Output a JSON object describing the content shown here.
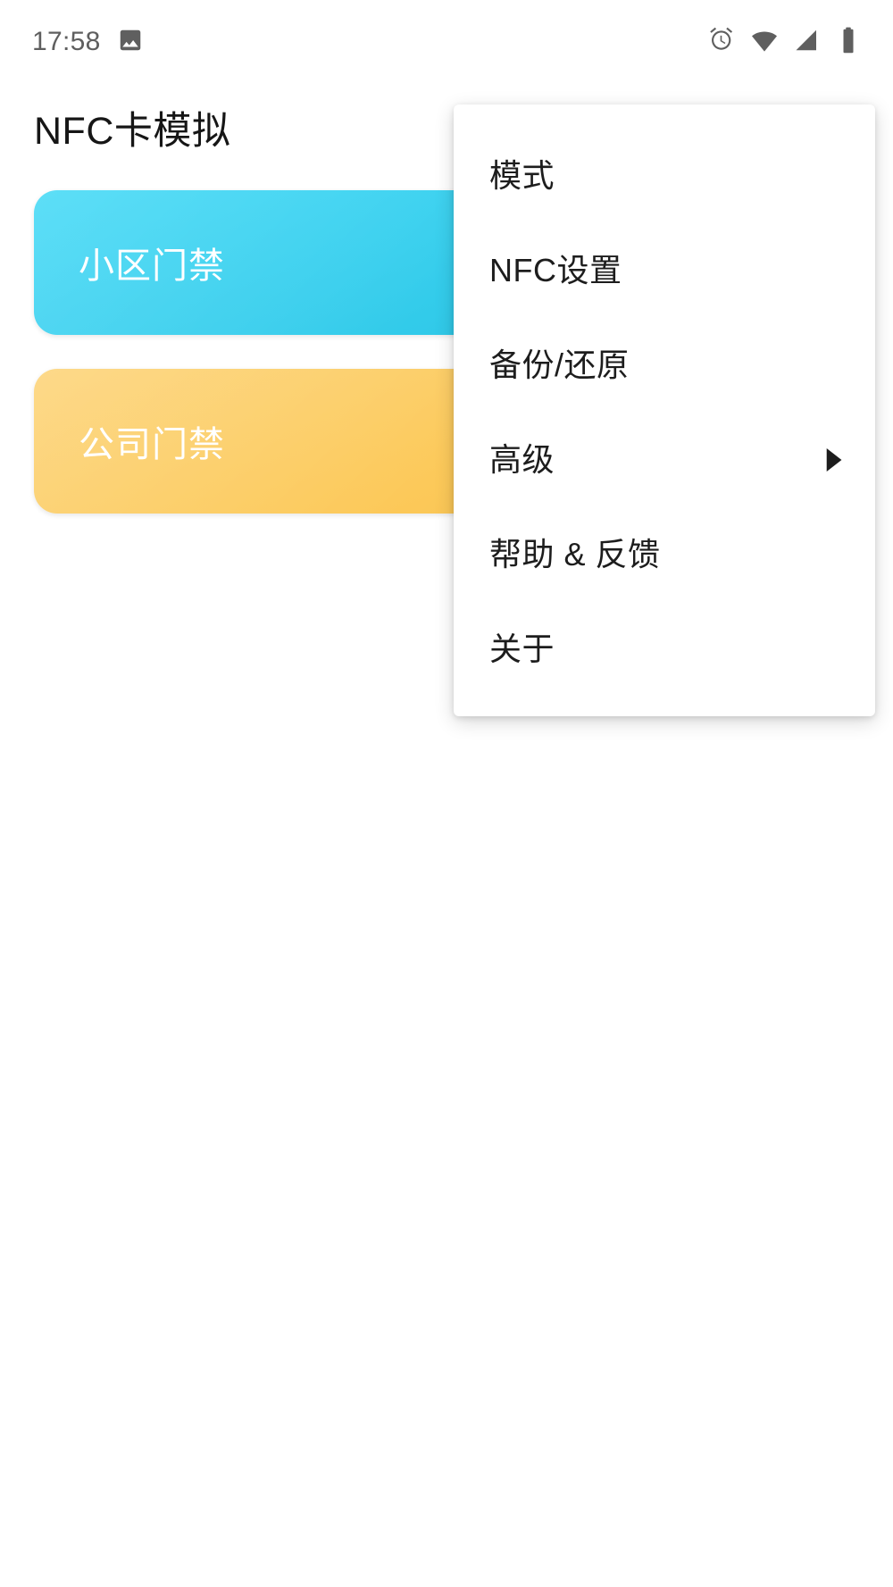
{
  "status_bar": {
    "time": "17:58",
    "left_icons": [
      {
        "name": "image-notification-icon",
        "glyph": "image"
      }
    ],
    "right_icons": [
      {
        "name": "alarm-clock-icon",
        "glyph": "alarm"
      },
      {
        "name": "wifi-icon",
        "glyph": "wifi"
      },
      {
        "name": "cellular-signal-icon",
        "glyph": "signal"
      },
      {
        "name": "battery-icon",
        "glyph": "battery"
      }
    ],
    "text_color": "#5f5f5f"
  },
  "app": {
    "title": "NFC卡模拟"
  },
  "cards": [
    {
      "label": "小区门禁",
      "color": "#35cdec"
    },
    {
      "label": "公司门禁",
      "color": "#fcca5c"
    }
  ],
  "overflow_menu": {
    "visible": true,
    "items": [
      {
        "label": "模式",
        "has_submenu": false
      },
      {
        "label": "NFC设置",
        "has_submenu": false
      },
      {
        "label": "备份/还原",
        "has_submenu": false
      },
      {
        "label": "高级",
        "has_submenu": true
      },
      {
        "label": "帮助 & 反馈",
        "has_submenu": false
      },
      {
        "label": "关于",
        "has_submenu": false
      }
    ]
  }
}
